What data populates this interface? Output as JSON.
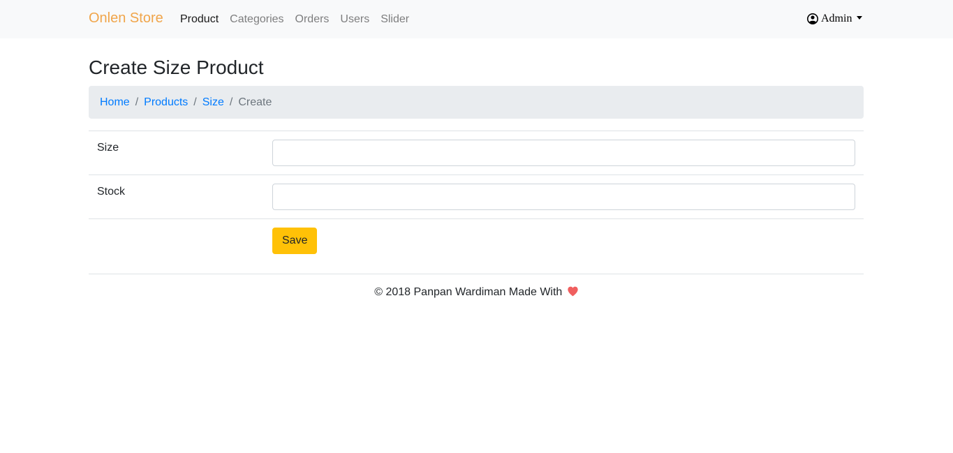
{
  "navbar": {
    "brand": "Onlen Store",
    "brand_color": "#f0a54a",
    "links": [
      {
        "label": "Product",
        "active": true
      },
      {
        "label": "Categories",
        "active": false
      },
      {
        "label": "Orders",
        "active": false
      },
      {
        "label": "Users",
        "active": false
      },
      {
        "label": "Slider",
        "active": false
      }
    ],
    "user": {
      "icon": "user-circle-icon",
      "label": "Admin",
      "caret_icon": "caret-down-icon"
    }
  },
  "page": {
    "title": "Create Size Product"
  },
  "breadcrumb": {
    "items": [
      "Home",
      "Products",
      "Size"
    ],
    "separator": "/",
    "current": "Create",
    "link_color": "#007bff"
  },
  "form": {
    "fields": [
      {
        "label": "Size",
        "value": "",
        "placeholder": ""
      },
      {
        "label": "Stock",
        "value": "",
        "placeholder": ""
      }
    ],
    "save_label": "Save",
    "save_color": "#ffc107"
  },
  "footer": {
    "text": "© 2018 Panpan Wardiman Made With",
    "icon": "heart-icon",
    "icon_color": "#f05f5f"
  }
}
